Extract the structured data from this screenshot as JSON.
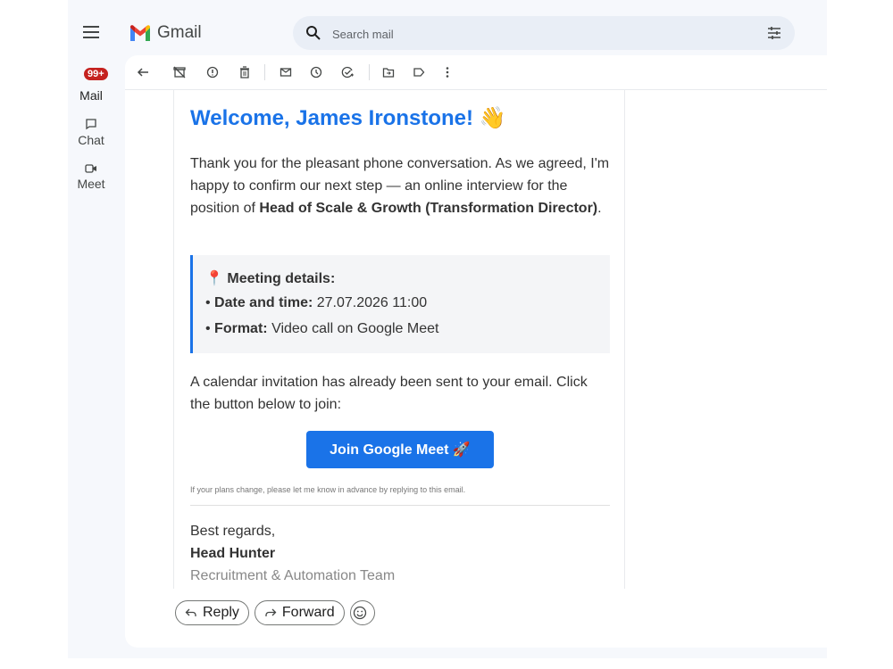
{
  "app": {
    "name": "Gmail"
  },
  "rail": {
    "badge": "99+",
    "items": [
      {
        "label": "Mail",
        "icon": "mail-icon"
      },
      {
        "label": "Chat",
        "icon": "chat-icon"
      },
      {
        "label": "Meet",
        "icon": "video-icon"
      }
    ]
  },
  "search": {
    "placeholder": "Search mail"
  },
  "toolbar": {
    "icons": [
      "back-arrow-icon",
      "archive-icon",
      "report-spam-icon",
      "delete-icon",
      "mark-unread-icon",
      "snooze-icon",
      "add-to-tasks-icon",
      "move-to-icon",
      "label-icon",
      "more-icon"
    ]
  },
  "email": {
    "heading": "Welcome, James Ironstone! 👋",
    "intro_pre": "Thank you for the pleasant phone conversation. As we agreed, I'm happy to confirm our next step — an online interview for the position of ",
    "intro_bold": "Head of Scale & Growth (Transformation Director)",
    "intro_post": ".",
    "details": {
      "title_icon": "📍",
      "title": "Meeting details:",
      "date_label": "Date and time:",
      "date_value": "27.07.2026 11:00",
      "format_label": "Format:",
      "format_value": "Video call on Google Meet"
    },
    "calendar_text": "A calendar invitation has already been sent to your email. Click the button below to join:",
    "button_label": "Join Google Meet 🚀",
    "small_note": "If your plans change, please let me know in advance by replying to this email.",
    "closing": "Best regards,",
    "sender_name": "Head Hunter",
    "sender_team": "Recruitment & Automation Team"
  },
  "actions": {
    "reply": "Reply",
    "forward": "Forward"
  },
  "colors": {
    "accent": "#1a73e8",
    "badge": "#c5221f",
    "background": "#f6f8fc"
  }
}
